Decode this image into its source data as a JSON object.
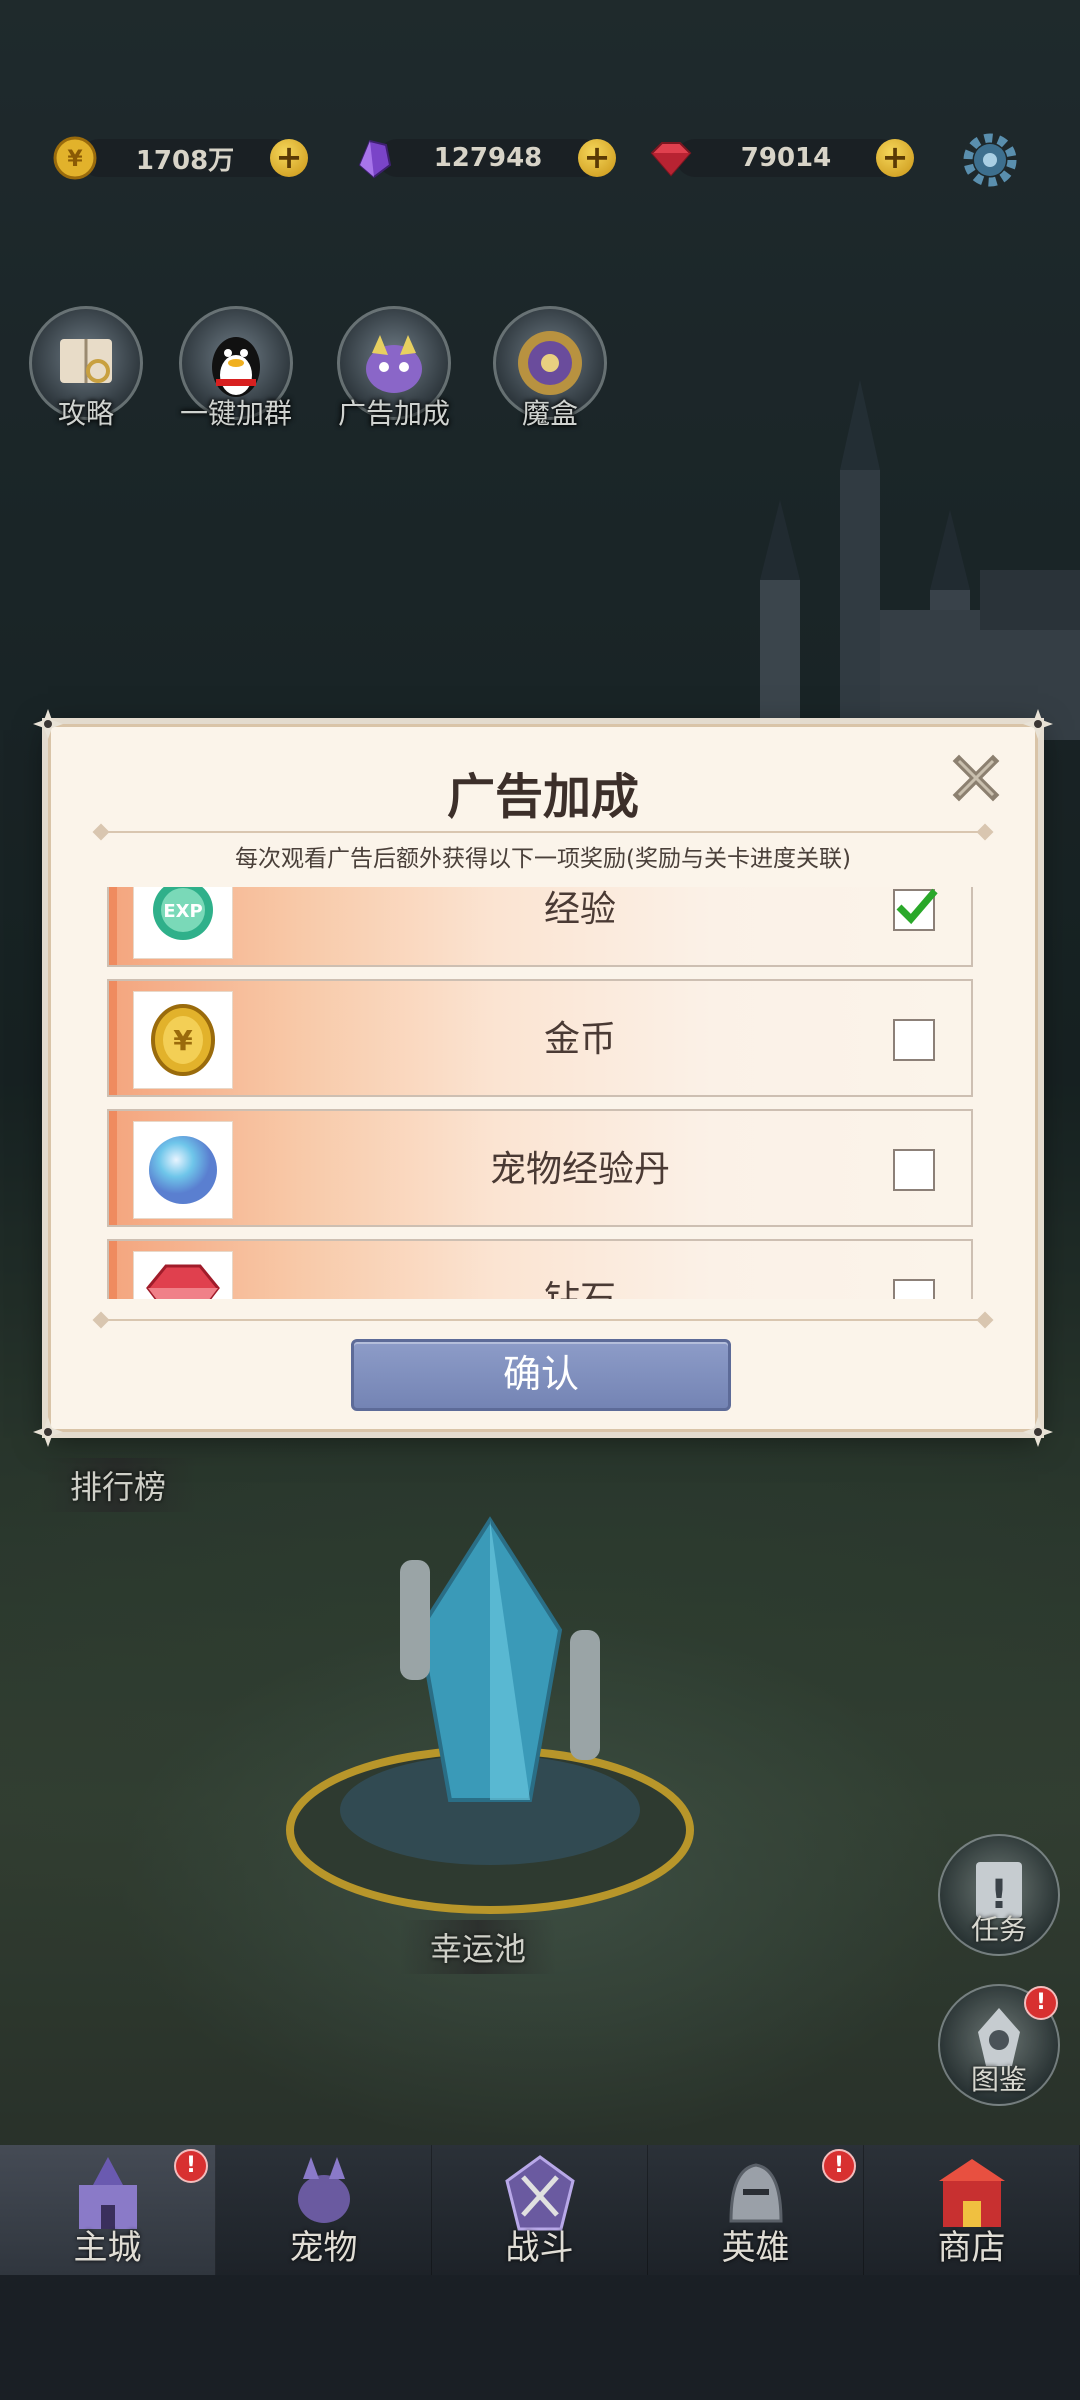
{
  "currency": [
    {
      "icon": "gold-coin-icon",
      "value": "1708万"
    },
    {
      "icon": "purple-crystal-icon",
      "value": "127948"
    },
    {
      "icon": "red-gem-icon",
      "value": "79014"
    }
  ],
  "quick_buttons": [
    {
      "label": "攻略",
      "icon": "guide-book-icon"
    },
    {
      "label": "一键加群",
      "icon": "qq-penguin-icon"
    },
    {
      "label": "广告加成",
      "icon": "ad-bonus-icon"
    },
    {
      "label": "魔盒",
      "icon": "magic-box-icon"
    }
  ],
  "dialog": {
    "title": "广告加成",
    "subtitle": "每次观看广告后额外获得以下一项奖励(奖励与关卡进度关联)",
    "rewards": [
      {
        "name": "经验",
        "icon": "exp-orb-icon",
        "checked": true
      },
      {
        "name": "金币",
        "icon": "gold-coin-icon",
        "checked": false
      },
      {
        "name": "宠物经验丹",
        "icon": "pet-exp-pill-icon",
        "checked": false
      },
      {
        "name": "钻石",
        "icon": "diamond-icon",
        "checked": false
      }
    ],
    "confirm_label": "确认"
  },
  "map": {
    "ranking_label": "排行榜",
    "lucky_pool_label": "幸运池",
    "task_label": "任务",
    "codex_label": "图鉴"
  },
  "nav": [
    {
      "label": "主城",
      "icon": "castle-icon",
      "badge": true
    },
    {
      "label": "宠物",
      "icon": "pet-icon",
      "badge": false
    },
    {
      "label": "战斗",
      "icon": "battle-icon",
      "badge": false
    },
    {
      "label": "英雄",
      "icon": "hero-helmet-icon",
      "badge": true
    },
    {
      "label": "商店",
      "icon": "shop-icon",
      "badge": false
    }
  ],
  "colors": {
    "accent": "#7484b4",
    "check": "#2aa82a",
    "badge": "#d83030"
  }
}
